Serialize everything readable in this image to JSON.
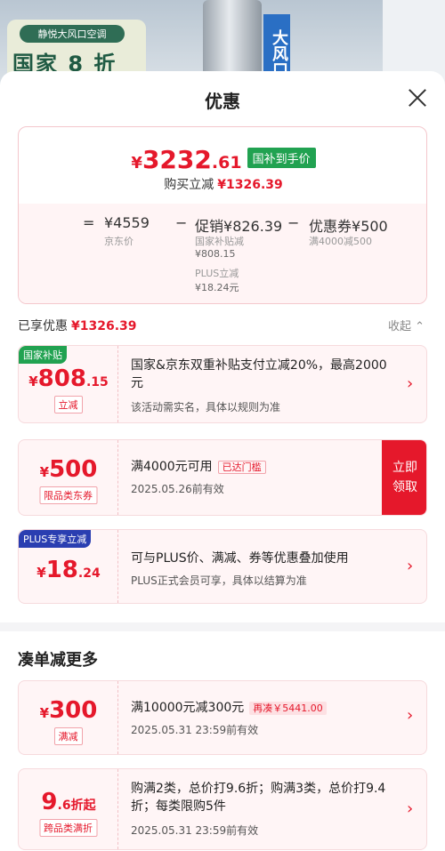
{
  "background": {
    "pill": "静悦大风口空调",
    "headline": "国家 8 折",
    "side_tag": "大风口"
  },
  "sheet": {
    "title": "优惠",
    "summary": {
      "price_symbol": "¥",
      "price_integer": "3232",
      "price_decimal": ".61",
      "price_badge": "国补到手价",
      "buy_label": "购买立减",
      "buy_amount": "¥1326.39",
      "equals": "=",
      "jd_price": "¥4559",
      "jd_price_label": "京东价",
      "minus1": "−",
      "promo_label": "促销",
      "promo_amount": "¥826.39",
      "promo_sub1_label": "国家补贴减",
      "promo_sub1_amount": "¥808.15",
      "promo_sub2_label": "PLUS立减",
      "promo_sub2_amount": "¥18.24元",
      "minus2": "−",
      "coupon_label": "优惠券",
      "coupon_amount": "¥500",
      "coupon_rule": "满4000减500"
    },
    "enjoyed_label": "已享优惠",
    "enjoyed_amount": "¥1326.39",
    "collapse_label": "收起"
  },
  "cards": [
    {
      "corner": "国家补贴",
      "symbol": "¥",
      "int": "808",
      "dec": ".15",
      "tag": "立减",
      "desc": "国家&京东双重补贴支付立减20%，最高2000元",
      "sub": "该活动需实名，具体以规则为准"
    },
    {
      "symbol": "¥",
      "int": "500",
      "dec": "",
      "tag": "限品类东券",
      "desc": "满4000元可用",
      "desc_tag": "已达门槛",
      "sub": "2025.05.26前有效",
      "action": "立即领取"
    },
    {
      "corner": "PLUS专享立减",
      "symbol": "¥",
      "int": "18",
      "dec": ".24",
      "desc": "可与PLUS价、满减、券等优惠叠加使用",
      "sub": "PLUS正式会员可享，具体以结算为准"
    }
  ],
  "more_section": {
    "title": "凑单减更多",
    "cards": [
      {
        "symbol": "¥",
        "int": "300",
        "tag": "满减",
        "desc": "满10000元减300元",
        "desc_tag": "再凑￥5441.00",
        "sub": "2025.05.31 23:59前有效"
      },
      {
        "int": "9",
        "dec": ".6",
        "unit": "折起",
        "tag": "跨品类满折",
        "desc": "购满2类，总价打9.6折；购满3类，总价打9.4折；每类限购5件",
        "sub": "2025.05.31 23:59前有效"
      }
    ]
  },
  "colors": {
    "accent": "#e5182b",
    "green": "#21a251",
    "plus_blue": "#2a3eb1"
  },
  "icons": {
    "close": "close-icon",
    "chevron": "chevron-right-icon",
    "collapse": "chevron-up-icon"
  }
}
